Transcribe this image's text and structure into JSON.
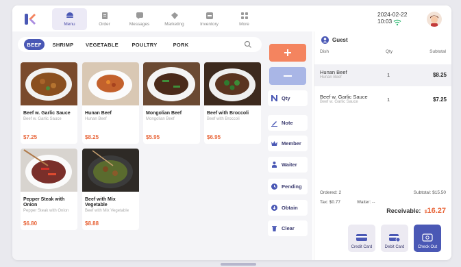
{
  "nav": {
    "items": [
      {
        "label": "Menu",
        "icon": "menu-icon",
        "active": true
      },
      {
        "label": "Order",
        "icon": "order-icon"
      },
      {
        "label": "Messages",
        "icon": "messages-icon"
      },
      {
        "label": "Marketing",
        "icon": "marketing-icon"
      },
      {
        "label": "Inventory",
        "icon": "inventory-icon"
      },
      {
        "label": "More",
        "icon": "more-icon"
      }
    ]
  },
  "status": {
    "date": "2024-02-22",
    "time": "10:03"
  },
  "categories": [
    "BEEF",
    "SHRIMP",
    "VEGETABLE",
    "POULTRY",
    "PORK"
  ],
  "dishes": [
    {
      "name": "Beef w. Garlic Sauce",
      "sub": "Beef w. Garlic Sauce",
      "price": "$7.25"
    },
    {
      "name": "Hunan Beef",
      "sub": "Hunan Beef",
      "price": "$8.25"
    },
    {
      "name": "Mongolian Beef",
      "sub": "Mongolian Beef",
      "price": "$5.95"
    },
    {
      "name": "Beef with Broccoli",
      "sub": "Beef with Broccoli",
      "price": "$6.95"
    },
    {
      "name": "Pepper Steak with Onion",
      "sub": "Pepper Steak with Onion",
      "price": "$6.80"
    },
    {
      "name": "Beef with Mix Vegetable",
      "sub": "Beef with Mix Vegetable",
      "price": "$8.88"
    }
  ],
  "actions": {
    "qty": "Qty",
    "note": "Note",
    "member": "Member",
    "waiter": "Waiter",
    "pending": "Pending",
    "obtain": "Obtain",
    "clear": "Clear"
  },
  "order": {
    "guest": "Guest",
    "headers": {
      "dish": "Dish",
      "qty": "Qty",
      "subtotal": "Subtotal"
    },
    "rows": [
      {
        "name": "Hunan Beef",
        "sub": "Hunan Beef",
        "qty": "1",
        "subtotal": "$8.25"
      },
      {
        "name": "Beef w. Garlic Sauce",
        "sub": "Beef w. Garlic Sauce",
        "qty": "1",
        "subtotal": "$7.25"
      }
    ],
    "ordered": "Ordered: 2",
    "subtotal": "Subtotal:  $15.50",
    "tax": "Tax:  $0.77",
    "waiter": "Waiter:  --",
    "receivable_label": "Receivable:",
    "currency": "$",
    "receivable_amount": "16.27"
  },
  "payments": {
    "credit": "Credit Card",
    "debit": "Debit Card",
    "checkout": "Check Out"
  },
  "colors": {
    "accent": "#4a58b5",
    "price": "#e8663a",
    "plus": "#f4845f",
    "minus": "#a9b6e6"
  }
}
